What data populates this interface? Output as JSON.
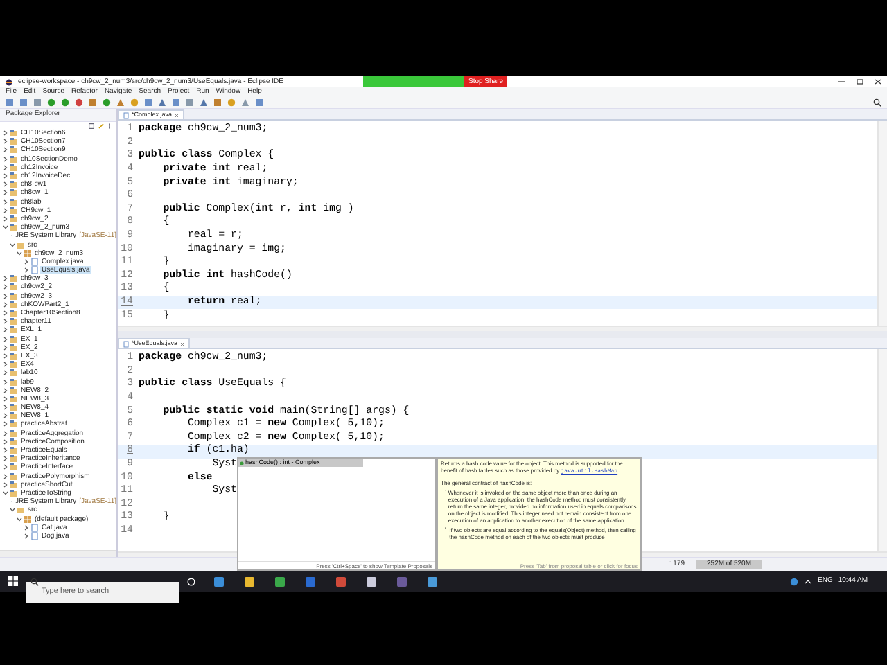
{
  "window": {
    "title": "eclipse-workspace - ch9cw_2_num3/src/ch9cw_2_num3/UseEquals.java - Eclipse IDE"
  },
  "share_bar": {
    "button": "Stop Share"
  },
  "menu": [
    "File",
    "Edit",
    "Source",
    "Refactor",
    "Navigate",
    "Search",
    "Project",
    "Run",
    "Window",
    "Help"
  ],
  "package_explorer": {
    "title": "Package Explorer",
    "items": [
      {
        "label": "CH10Section6",
        "kind": "project",
        "expanded": false,
        "selected": false
      },
      {
        "label": "CH10Section7",
        "kind": "project",
        "expanded": false,
        "selected": false
      },
      {
        "label": "CH10Section9",
        "kind": "project",
        "expanded": false,
        "selected": false
      },
      {
        "label": "ch10SectionDemo",
        "kind": "project",
        "expanded": false,
        "selected": false
      },
      {
        "label": "ch12Invoice",
        "kind": "project",
        "expanded": false,
        "selected": false
      },
      {
        "label": "ch12InvoiceDec",
        "kind": "project",
        "expanded": false,
        "selected": false
      },
      {
        "label": "ch8-cw1",
        "kind": "project",
        "expanded": false,
        "selected": false
      },
      {
        "label": "ch8cw_1",
        "kind": "project",
        "expanded": false,
        "selected": false
      },
      {
        "label": "ch8lab",
        "kind": "project",
        "expanded": false,
        "selected": false
      },
      {
        "label": "CH9cw_1",
        "kind": "project",
        "expanded": false,
        "selected": false
      },
      {
        "label": "ch9cw_2",
        "kind": "project",
        "expanded": false,
        "selected": false
      },
      {
        "label": "ch9cw_2_num3",
        "kind": "project",
        "expanded": true,
        "selected": false,
        "children": [
          {
            "label": "JRE System Library",
            "note": "[JavaSE-11]",
            "kind": "library",
            "expanded": false,
            "selected": false
          },
          {
            "label": "src",
            "kind": "folder",
            "expanded": true,
            "selected": false,
            "children": [
              {
                "label": "ch9cw_2_num3",
                "kind": "package",
                "expanded": true,
                "selected": false,
                "children": [
                  {
                    "label": "Complex.java",
                    "kind": "file",
                    "expanded": false,
                    "selected": false
                  },
                  {
                    "label": "UseEquals.java",
                    "kind": "file",
                    "expanded": false,
                    "selected": true
                  }
                ]
              }
            ]
          }
        ]
      },
      {
        "label": "ch9cw_3",
        "kind": "project",
        "expanded": false,
        "selected": false
      },
      {
        "label": "ch9cw2_2",
        "kind": "project",
        "expanded": false,
        "selected": false
      },
      {
        "label": "ch9cw2_3",
        "kind": "project",
        "expanded": false,
        "selected": false
      },
      {
        "label": "chKOWPart2_1",
        "kind": "project",
        "expanded": false,
        "selected": false
      },
      {
        "label": "Chapter10Section8",
        "kind": "project",
        "expanded": false,
        "selected": false
      },
      {
        "label": "chapter11",
        "kind": "project",
        "expanded": false,
        "selected": false
      },
      {
        "label": "EXL_1",
        "kind": "project",
        "expanded": false,
        "selected": false
      },
      {
        "label": "EX_1",
        "kind": "project",
        "expanded": false,
        "selected": false
      },
      {
        "label": "EX_2",
        "kind": "project",
        "expanded": false,
        "selected": false
      },
      {
        "label": "EX_3",
        "kind": "project",
        "expanded": false,
        "selected": false
      },
      {
        "label": "EX4",
        "kind": "project",
        "expanded": false,
        "selected": false
      },
      {
        "label": "lab10",
        "kind": "project",
        "expanded": false,
        "selected": false
      },
      {
        "label": "lab9",
        "kind": "project",
        "expanded": false,
        "selected": false
      },
      {
        "label": "NEW8_2",
        "kind": "project",
        "expanded": false,
        "selected": false
      },
      {
        "label": "NEW8_3",
        "kind": "project",
        "expanded": false,
        "selected": false
      },
      {
        "label": "NEW8_4",
        "kind": "project",
        "expanded": false,
        "selected": false
      },
      {
        "label": "NEW8_1",
        "kind": "project",
        "expanded": false,
        "selected": false
      },
      {
        "label": "practiceAbstrat",
        "kind": "project",
        "expanded": false,
        "selected": false
      },
      {
        "label": "PracticeAggregation",
        "kind": "project",
        "expanded": false,
        "selected": false
      },
      {
        "label": "PracticeComposition",
        "kind": "project",
        "expanded": false,
        "selected": false
      },
      {
        "label": "PracticeEquals",
        "kind": "project",
        "expanded": false,
        "selected": false
      },
      {
        "label": "PracticeInheritance",
        "kind": "project",
        "expanded": false,
        "selected": false
      },
      {
        "label": "PracticeInterface",
        "kind": "project",
        "expanded": false,
        "selected": false
      },
      {
        "label": "PracticePolymorphism",
        "kind": "project",
        "expanded": false,
        "selected": false
      },
      {
        "label": "practiceShortCut",
        "kind": "project",
        "expanded": false,
        "selected": false
      },
      {
        "label": "PracticeToString",
        "kind": "project",
        "expanded": true,
        "selected": false,
        "children": [
          {
            "label": "JRE System Library",
            "note": "[JavaSE-11]",
            "kind": "library",
            "expanded": false,
            "selected": false
          },
          {
            "label": "src",
            "kind": "folder",
            "expanded": true,
            "selected": false,
            "children": [
              {
                "label": "(default package)",
                "kind": "package",
                "expanded": true,
                "selected": false,
                "children": [
                  {
                    "label": "Cat.java",
                    "kind": "file",
                    "expanded": false,
                    "selected": false
                  },
                  {
                    "label": "Dog.java",
                    "kind": "file",
                    "expanded": false,
                    "selected": false
                  }
                ]
              }
            ]
          }
        ]
      }
    ]
  },
  "editors": [
    {
      "tab": "*Complex.java",
      "lines": [
        {
          "number": "1",
          "code": "**package** ch9cw_2_num3;",
          "current": false
        },
        {
          "number": "2",
          "current": false
        },
        {
          "number": "3",
          "code": "**public** **class** Complex {",
          "current": false
        },
        {
          "number": "4",
          "code": "    **private** **int** real;",
          "current": false
        },
        {
          "number": "5",
          "code": "    **private** **int** imaginary;",
          "current": false
        },
        {
          "number": "6",
          "current": false
        },
        {
          "number": "7",
          "code": "    **public** Complex(**int** r, **int** img )",
          "current": false
        },
        {
          "number": "8",
          "code": "    {",
          "current": false
        },
        {
          "number": "9",
          "code": "        real = r;",
          "current": false
        },
        {
          "number": "10",
          "code": "        imaginary = img;",
          "current": false
        },
        {
          "number": "11",
          "code": "    }",
          "current": false
        },
        {
          "number": "12",
          "code": "    **public** **int** hashCode()",
          "current": false
        },
        {
          "number": "13",
          "code": "    {",
          "current": false
        },
        {
          "number": "14",
          "code": "        **return** real;",
          "current": true
        },
        {
          "number": "15",
          "code": "    }",
          "current": false
        }
      ]
    },
    {
      "tab": "*UseEquals.java",
      "lines": [
        {
          "number": "1",
          "code": "**package** ch9cw_2_num3;",
          "current": false
        },
        {
          "number": "2",
          "current": false
        },
        {
          "number": "3",
          "code": "**public** **class** UseEquals {",
          "current": false
        },
        {
          "number": "4",
          "current": false
        },
        {
          "number": "5",
          "code": "    **public** **static** **void** main(String[] args) {",
          "current": false
        },
        {
          "number": "6",
          "code": "        Complex c1 = **new** Complex( 5,10);",
          "current": false
        },
        {
          "number": "7",
          "code": "        Complex c2 = **new** Complex( 5,10);",
          "current": false
        },
        {
          "number": "8",
          "code": "        **if** (c1.ha)",
          "current": true
        },
        {
          "number": "9",
          "code": "            Syst",
          "current": false
        },
        {
          "number": "10",
          "code": "        **else**",
          "current": false
        },
        {
          "number": "11",
          "code": "            Syst",
          "current": false
        },
        {
          "number": "12",
          "current": false
        },
        {
          "number": "13",
          "code": "    }",
          "current": false
        },
        {
          "number": "14",
          "current": false
        }
      ]
    }
  ],
  "completion": {
    "items": [
      {
        "label": "hashCode() : int - Complex",
        "selected": true
      }
    ],
    "footer": "Press 'Ctrl+Space' to show Template Proposals"
  },
  "doc": {
    "summary": "Returns a hash code value for the object. This method is supported for the benefit of hash tables such as those provided by ",
    "link": "java.util.HashMap",
    "summary_end": ".",
    "heading": "The general contract of hashCode is:",
    "bullets": [
      "Whenever it is invoked on the same object more than once during an execution of a Java application, the hashCode method must consistently return the same integer, provided no information used in equals comparisons on the object is modified. This integer need not remain consistent from one execution of an application to another execution of the same application.",
      "If two objects are equal according to the equals(Object) method, then calling the hashCode method on each of the two objects must produce"
    ],
    "footer": "Press 'Tab' from proposal table or click for focus"
  },
  "status_bar": {
    "position": ": 179",
    "memory": "252M of 520M"
  },
  "taskbar": {
    "search_placeholder": "Type here to search",
    "language": "ENG",
    "time": "10:44 AM"
  }
}
